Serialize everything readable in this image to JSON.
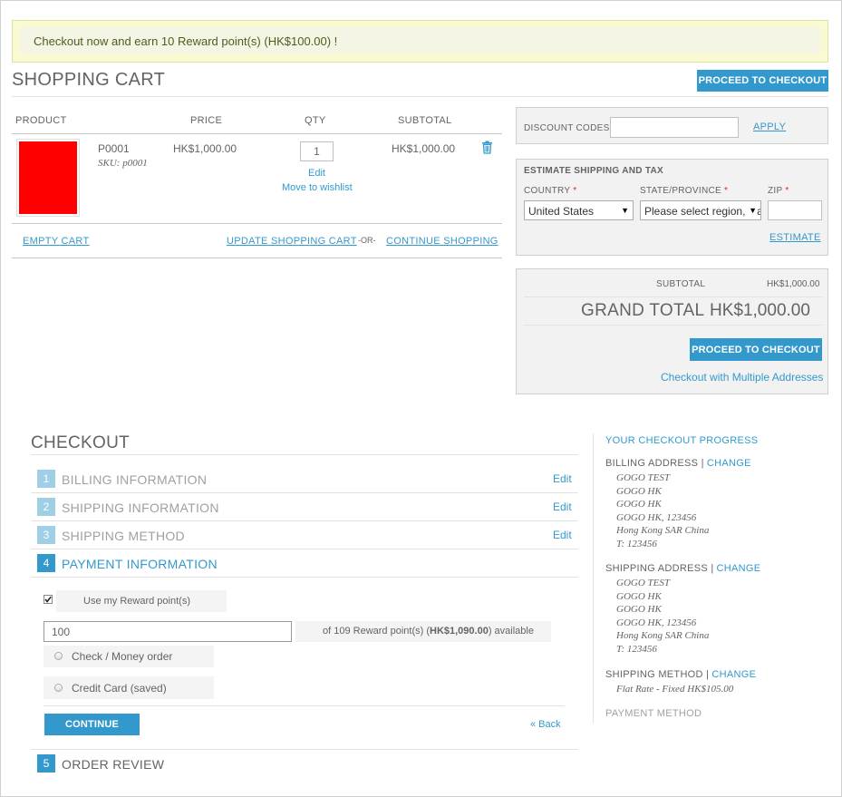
{
  "notice": {
    "text": "Checkout now and earn 10 Reward point(s) (HK$100.00) !"
  },
  "cart": {
    "title": "SHOPPING CART",
    "proceed_label": "PROCEED TO CHECKOUT",
    "columns": {
      "product": "PRODUCT",
      "price": "PRICE",
      "qty": "QTY",
      "subtotal": "SUBTOTAL"
    },
    "item": {
      "name": "P0001",
      "sku": "SKU: p0001",
      "price": "HK$1,000.00",
      "qty": "1",
      "subtotal": "HK$1,000.00",
      "edit": "Edit",
      "wishlist": "Move to wishlist",
      "image_color": "#ff0000"
    },
    "empty_cart": "EMPTY CART",
    "update_cart": "UPDATE SHOPPING CART",
    "or": "-OR-",
    "continue_shopping": "CONTINUE SHOPPING"
  },
  "discount": {
    "label": "DISCOUNT CODES",
    "value": "",
    "apply": "APPLY"
  },
  "shipping_estimate": {
    "title": "ESTIMATE SHIPPING AND TAX",
    "country_label": "COUNTRY",
    "country_value": "United States",
    "state_label": "STATE/PROVINCE",
    "state_value": "Please select region, state or province",
    "zip_label": "ZIP",
    "zip_value": "",
    "required_mark": "*",
    "estimate": "ESTIMATE"
  },
  "totals": {
    "subtotal_label": "SUBTOTAL",
    "subtotal_value": "HK$1,000.00",
    "grand_total_label": "GRAND TOTAL",
    "grand_total_value": "HK$1,000.00",
    "proceed_label": "PROCEED TO CHECKOUT",
    "multi_address": "Checkout with Multiple Addresses"
  },
  "checkout": {
    "title": "CHECKOUT",
    "steps": [
      {
        "num": "1",
        "label": "BILLING INFORMATION",
        "edit": "Edit"
      },
      {
        "num": "2",
        "label": "SHIPPING INFORMATION",
        "edit": "Edit"
      },
      {
        "num": "3",
        "label": "SHIPPING METHOD",
        "edit": "Edit"
      },
      {
        "num": "4",
        "label": "PAYMENT INFORMATION"
      },
      {
        "num": "5",
        "label": "ORDER REVIEW"
      }
    ],
    "payment": {
      "use_points_label": "Use my Reward point(s)",
      "use_points_checked": true,
      "points_value": "100",
      "points_info_prefix": "of 109 Reward point(s) (",
      "points_info_amount": "HK$1,090.00",
      "points_info_suffix": ") available",
      "method_check": "Check / Money order",
      "method_card": "Credit Card (saved)",
      "continue": "CONTINUE",
      "back": "« Back"
    }
  },
  "progress": {
    "title": "YOUR CHECKOUT PROGRESS",
    "separator": "|",
    "change": "CHANGE",
    "billing_label": "BILLING ADDRESS",
    "billing_lines": [
      "GOGO TEST",
      "GOGO HK",
      "GOGO HK",
      "GOGO HK, 123456",
      "Hong Kong SAR China",
      "T: 123456"
    ],
    "shipping_label": "SHIPPING ADDRESS",
    "shipping_lines": [
      "GOGO TEST",
      "GOGO HK",
      "GOGO HK",
      "GOGO HK, 123456",
      "Hong Kong SAR China",
      "T: 123456"
    ],
    "method_label": "SHIPPING METHOD",
    "method_value": "Flat Rate - Fixed HK$105.00",
    "payment_label": "PAYMENT METHOD"
  },
  "colors": {
    "accent": "#3399cc",
    "accent_light": "#9fcfe5",
    "required": "#df280a",
    "notice_bg": "#fafad2"
  }
}
